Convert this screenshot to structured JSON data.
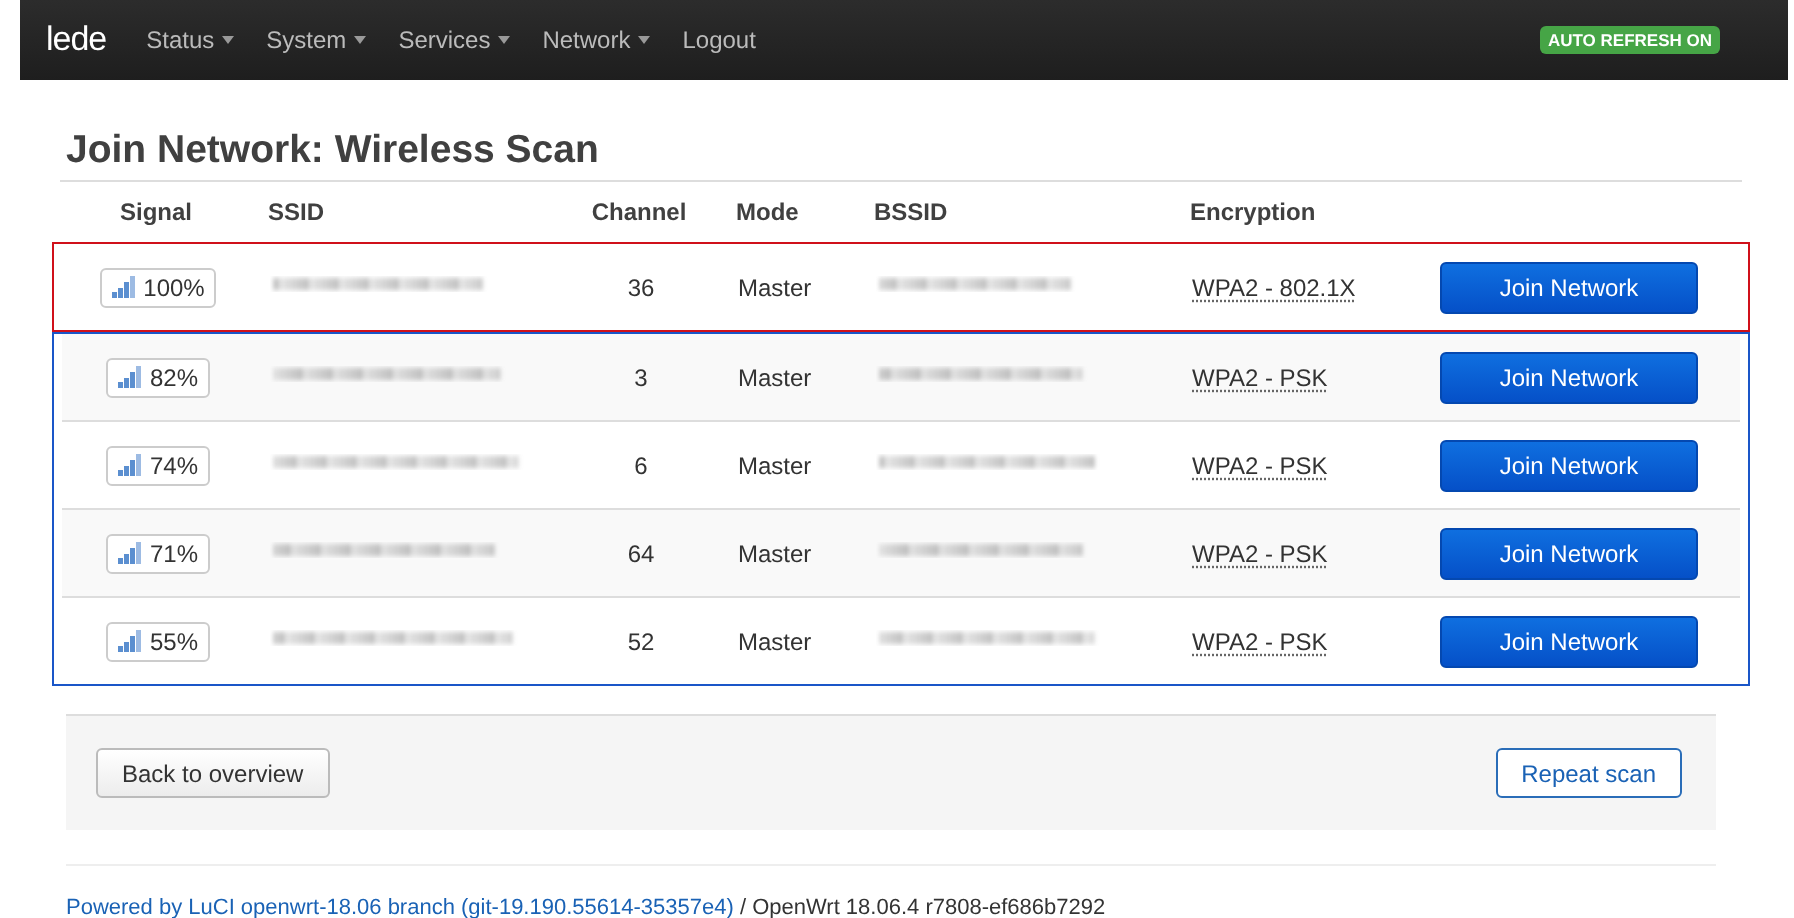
{
  "navbar": {
    "brand": "lede",
    "menus": [
      {
        "label": "Status",
        "dropdown": true
      },
      {
        "label": "System",
        "dropdown": true
      },
      {
        "label": "Services",
        "dropdown": true
      },
      {
        "label": "Network",
        "dropdown": true
      },
      {
        "label": "Logout",
        "dropdown": false
      }
    ],
    "badge": "AUTO REFRESH ON"
  },
  "title": "Join Network: Wireless Scan",
  "table": {
    "columns": [
      "Signal",
      "SSID",
      "Channel",
      "Mode",
      "BSSID",
      "Encryption"
    ],
    "groups": [
      {
        "color": "#d0101a",
        "rows": [
          {
            "signal": "100%",
            "channel": "36",
            "mode": "Master",
            "encryption": "WPA2 - 802.1X",
            "action": "Join Network"
          }
        ]
      },
      {
        "color": "#1a56c8",
        "rows": [
          {
            "signal": "82%",
            "channel": "3",
            "mode": "Master",
            "encryption": "WPA2 - PSK",
            "action": "Join Network"
          },
          {
            "signal": "74%",
            "channel": "6",
            "mode": "Master",
            "encryption": "WPA2 - PSK",
            "action": "Join Network"
          },
          {
            "signal": "71%",
            "channel": "64",
            "mode": "Master",
            "encryption": "WPA2 - PSK",
            "action": "Join Network"
          },
          {
            "signal": "55%",
            "channel": "52",
            "mode": "Master",
            "encryption": "WPA2 - PSK",
            "action": "Join Network"
          }
        ]
      }
    ]
  },
  "actions": {
    "back": "Back to overview",
    "repeat": "Repeat scan"
  },
  "footer": {
    "link": "Powered by LuCI openwrt-18.06 branch (git-19.190.55614-35357e4)",
    "text": "/ OpenWrt 18.06.4 r7808-ef686b7292"
  }
}
